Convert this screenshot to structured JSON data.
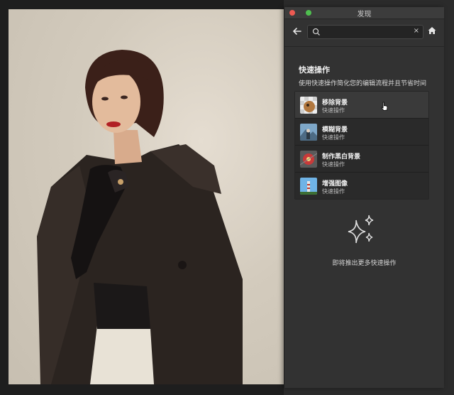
{
  "window": {
    "title": "发现"
  },
  "search": {
    "placeholder": "",
    "value": "",
    "clear_label": "×"
  },
  "panel": {
    "section_title": "快速操作",
    "section_desc": "使用快速操作简化您的编辑流程并且节省时间",
    "actions": [
      {
        "label": "移除背景",
        "sub": "快速操作",
        "icon": "dog-thumbnail"
      },
      {
        "label": "模糊背景",
        "sub": "快速操作",
        "icon": "mountain-thumbnail"
      },
      {
        "label": "制作黑白背景",
        "sub": "快速操作",
        "icon": "flower-thumbnail"
      },
      {
        "label": "增强图像",
        "sub": "快速操作",
        "icon": "lighthouse-thumbnail"
      }
    ],
    "coming_soon": "即将推出更多快速操作"
  },
  "colors": {
    "panel_bg": "#323232",
    "titlebar_close": "#ee5a52",
    "titlebar_zoom": "#4fbf4f",
    "photo_bg": "#d3cbbd"
  }
}
